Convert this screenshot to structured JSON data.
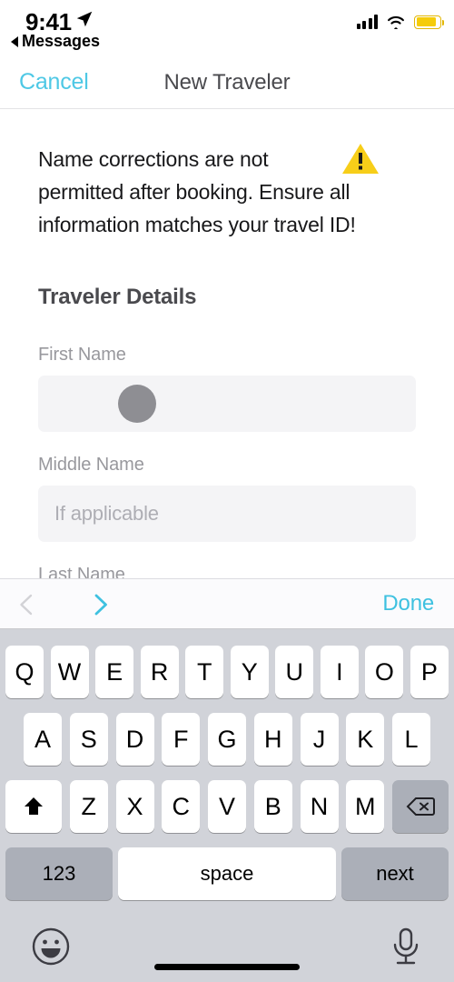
{
  "status_bar": {
    "time": "9:41",
    "back_label": "Messages",
    "location_icon": "location-arrow-icon",
    "signal_icon": "cellular-signal-icon",
    "wifi_icon": "wifi-icon",
    "battery_icon": "battery-icon",
    "battery_color": "#F5CC0A"
  },
  "nav_bar": {
    "cancel_label": "Cancel",
    "title": "New Traveler",
    "accent_color": "#4EC8E5"
  },
  "notice": {
    "text": "Name corrections are not permitted after booking. Ensure all information matches your travel ID!",
    "icon": "warning-triangle-icon",
    "icon_color": "#F7CE19"
  },
  "form": {
    "section_title": "Traveler Details",
    "fields": [
      {
        "label": "First Name",
        "value": "",
        "placeholder": ""
      },
      {
        "label": "Middle Name",
        "value": "",
        "placeholder": "If applicable"
      },
      {
        "label": "Last Name",
        "value": "",
        "placeholder": ""
      }
    ]
  },
  "accessory_bar": {
    "prev_icon": "chevron-left-icon",
    "next_icon": "chevron-right-icon",
    "prev_enabled": false,
    "next_enabled": true,
    "done_label": "Done",
    "accent_color": "#3EC1E0"
  },
  "keyboard": {
    "row1": [
      "Q",
      "W",
      "E",
      "R",
      "T",
      "Y",
      "U",
      "I",
      "O",
      "P"
    ],
    "row2": [
      "A",
      "S",
      "D",
      "F",
      "G",
      "H",
      "J",
      "K",
      "L"
    ],
    "row3": [
      "Z",
      "X",
      "C",
      "V",
      "B",
      "N",
      "M"
    ],
    "shift_icon": "shift-arrow-icon",
    "backspace_icon": "backspace-delete-icon",
    "numbers_label": "123",
    "space_label": "space",
    "return_label": "next",
    "emoji_icon": "emoji-smiley-icon",
    "dictation_icon": "microphone-icon",
    "home_indicator": "home-indicator-bar"
  }
}
